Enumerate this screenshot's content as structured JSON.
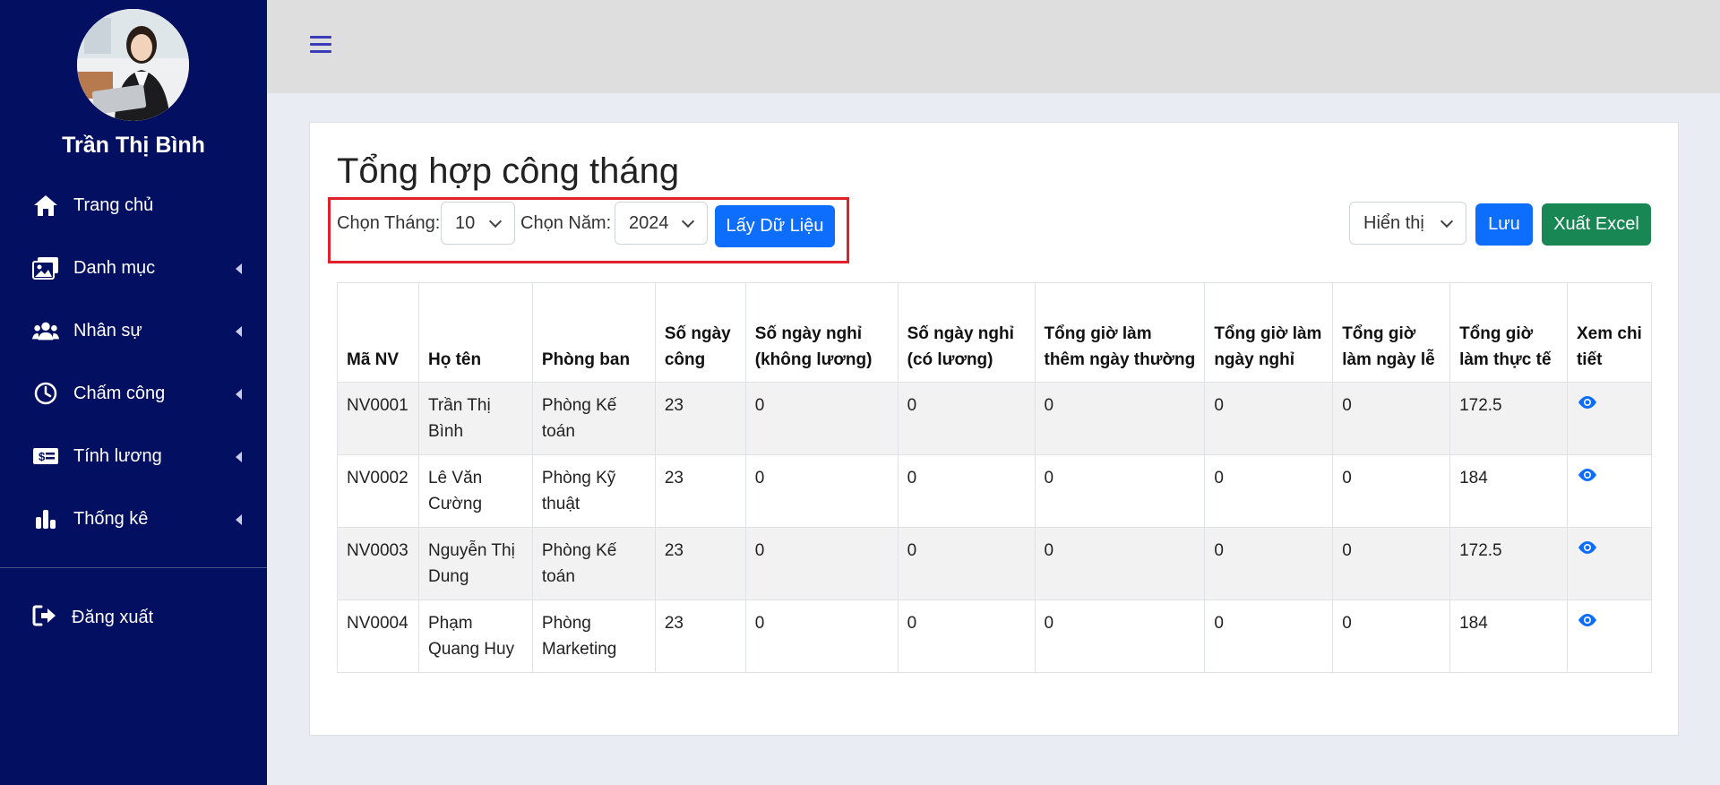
{
  "sidebar": {
    "user_name": "Trần Thị Bình",
    "items": [
      {
        "label": "Trang chủ",
        "icon": "home-icon"
      },
      {
        "label": "Danh mục",
        "icon": "images-icon"
      },
      {
        "label": "Nhân sự",
        "icon": "users-icon"
      },
      {
        "label": "Chấm công",
        "icon": "clock-icon"
      },
      {
        "label": "Tính lương",
        "icon": "money-bill-icon"
      },
      {
        "label": "Thống kê",
        "icon": "chart-bar-icon"
      }
    ],
    "logout_label": "Đăng xuất"
  },
  "page": {
    "title": "Tổng hợp công tháng",
    "filters": {
      "month_label": "Chọn Tháng:",
      "month_value": "10",
      "year_label": "Chọn Năm:",
      "year_value": "2024",
      "fetch_button": "Lấy Dữ Liệu"
    },
    "actions": {
      "display_select": "Hiển thị",
      "save_button": "Lưu",
      "export_button": "Xuất Excel"
    }
  },
  "table": {
    "headers": [
      "Mã NV",
      "Họ tên",
      "Phòng ban",
      "Số ngày công",
      "Số ngày nghỉ (không lương)",
      "Số ngày nghỉ (có lương)",
      "Tổng giờ làm thêm ngày thường",
      "Tổng giờ làm ngày nghỉ",
      "Tổng giờ làm ngày lễ",
      "Tổng giờ làm thực tế",
      "Xem chi tiết"
    ],
    "rows": [
      [
        "NV0001",
        "Trần Thị Bình",
        "Phòng Kế toán",
        "23",
        "0",
        "0",
        "0",
        "0",
        "0",
        "172.5"
      ],
      [
        "NV0002",
        "Lê Văn Cường",
        "Phòng Kỹ thuật",
        "23",
        "0",
        "0",
        "0",
        "0",
        "0",
        "184"
      ],
      [
        "NV0003",
        "Nguyễn Thị Dung",
        "Phòng Kế toán",
        "23",
        "0",
        "0",
        "0",
        "0",
        "0",
        "172.5"
      ],
      [
        "NV0004",
        "Phạm Quang Huy",
        "Phòng Marketing",
        "23",
        "0",
        "0",
        "0",
        "0",
        "0",
        "184"
      ]
    ]
  },
  "colors": {
    "sidebar_bg": "#030f60",
    "primary": "#0d6efd",
    "success": "#198754",
    "highlight_border": "#e0202a"
  }
}
